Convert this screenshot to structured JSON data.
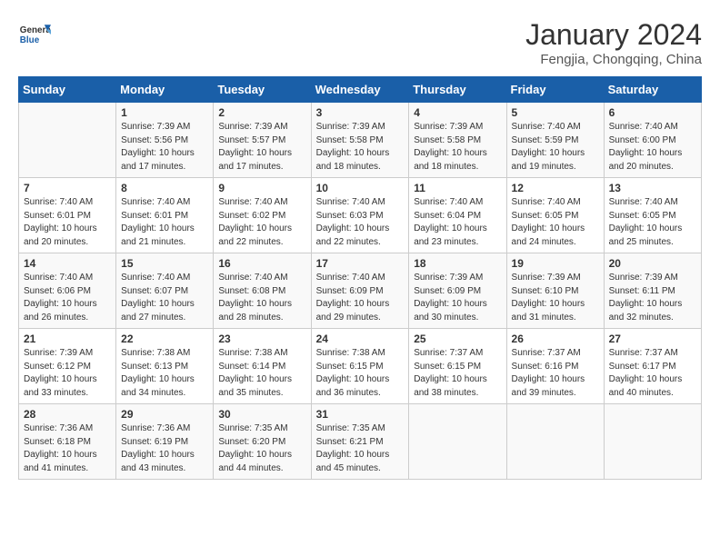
{
  "header": {
    "logo_general": "General",
    "logo_blue": "Blue",
    "title": "January 2024",
    "subtitle": "Fengjia, Chongqing, China"
  },
  "calendar": {
    "days_of_week": [
      "Sunday",
      "Monday",
      "Tuesday",
      "Wednesday",
      "Thursday",
      "Friday",
      "Saturday"
    ],
    "weeks": [
      [
        {
          "day": "",
          "info": ""
        },
        {
          "day": "1",
          "info": "Sunrise: 7:39 AM\nSunset: 5:56 PM\nDaylight: 10 hours\nand 17 minutes."
        },
        {
          "day": "2",
          "info": "Sunrise: 7:39 AM\nSunset: 5:57 PM\nDaylight: 10 hours\nand 17 minutes."
        },
        {
          "day": "3",
          "info": "Sunrise: 7:39 AM\nSunset: 5:58 PM\nDaylight: 10 hours\nand 18 minutes."
        },
        {
          "day": "4",
          "info": "Sunrise: 7:39 AM\nSunset: 5:58 PM\nDaylight: 10 hours\nand 18 minutes."
        },
        {
          "day": "5",
          "info": "Sunrise: 7:40 AM\nSunset: 5:59 PM\nDaylight: 10 hours\nand 19 minutes."
        },
        {
          "day": "6",
          "info": "Sunrise: 7:40 AM\nSunset: 6:00 PM\nDaylight: 10 hours\nand 20 minutes."
        }
      ],
      [
        {
          "day": "7",
          "info": "Sunrise: 7:40 AM\nSunset: 6:01 PM\nDaylight: 10 hours\nand 20 minutes."
        },
        {
          "day": "8",
          "info": "Sunrise: 7:40 AM\nSunset: 6:01 PM\nDaylight: 10 hours\nand 21 minutes."
        },
        {
          "day": "9",
          "info": "Sunrise: 7:40 AM\nSunset: 6:02 PM\nDaylight: 10 hours\nand 22 minutes."
        },
        {
          "day": "10",
          "info": "Sunrise: 7:40 AM\nSunset: 6:03 PM\nDaylight: 10 hours\nand 22 minutes."
        },
        {
          "day": "11",
          "info": "Sunrise: 7:40 AM\nSunset: 6:04 PM\nDaylight: 10 hours\nand 23 minutes."
        },
        {
          "day": "12",
          "info": "Sunrise: 7:40 AM\nSunset: 6:05 PM\nDaylight: 10 hours\nand 24 minutes."
        },
        {
          "day": "13",
          "info": "Sunrise: 7:40 AM\nSunset: 6:05 PM\nDaylight: 10 hours\nand 25 minutes."
        }
      ],
      [
        {
          "day": "14",
          "info": "Sunrise: 7:40 AM\nSunset: 6:06 PM\nDaylight: 10 hours\nand 26 minutes."
        },
        {
          "day": "15",
          "info": "Sunrise: 7:40 AM\nSunset: 6:07 PM\nDaylight: 10 hours\nand 27 minutes."
        },
        {
          "day": "16",
          "info": "Sunrise: 7:40 AM\nSunset: 6:08 PM\nDaylight: 10 hours\nand 28 minutes."
        },
        {
          "day": "17",
          "info": "Sunrise: 7:40 AM\nSunset: 6:09 PM\nDaylight: 10 hours\nand 29 minutes."
        },
        {
          "day": "18",
          "info": "Sunrise: 7:39 AM\nSunset: 6:09 PM\nDaylight: 10 hours\nand 30 minutes."
        },
        {
          "day": "19",
          "info": "Sunrise: 7:39 AM\nSunset: 6:10 PM\nDaylight: 10 hours\nand 31 minutes."
        },
        {
          "day": "20",
          "info": "Sunrise: 7:39 AM\nSunset: 6:11 PM\nDaylight: 10 hours\nand 32 minutes."
        }
      ],
      [
        {
          "day": "21",
          "info": "Sunrise: 7:39 AM\nSunset: 6:12 PM\nDaylight: 10 hours\nand 33 minutes."
        },
        {
          "day": "22",
          "info": "Sunrise: 7:38 AM\nSunset: 6:13 PM\nDaylight: 10 hours\nand 34 minutes."
        },
        {
          "day": "23",
          "info": "Sunrise: 7:38 AM\nSunset: 6:14 PM\nDaylight: 10 hours\nand 35 minutes."
        },
        {
          "day": "24",
          "info": "Sunrise: 7:38 AM\nSunset: 6:15 PM\nDaylight: 10 hours\nand 36 minutes."
        },
        {
          "day": "25",
          "info": "Sunrise: 7:37 AM\nSunset: 6:15 PM\nDaylight: 10 hours\nand 38 minutes."
        },
        {
          "day": "26",
          "info": "Sunrise: 7:37 AM\nSunset: 6:16 PM\nDaylight: 10 hours\nand 39 minutes."
        },
        {
          "day": "27",
          "info": "Sunrise: 7:37 AM\nSunset: 6:17 PM\nDaylight: 10 hours\nand 40 minutes."
        }
      ],
      [
        {
          "day": "28",
          "info": "Sunrise: 7:36 AM\nSunset: 6:18 PM\nDaylight: 10 hours\nand 41 minutes."
        },
        {
          "day": "29",
          "info": "Sunrise: 7:36 AM\nSunset: 6:19 PM\nDaylight: 10 hours\nand 43 minutes."
        },
        {
          "day": "30",
          "info": "Sunrise: 7:35 AM\nSunset: 6:20 PM\nDaylight: 10 hours\nand 44 minutes."
        },
        {
          "day": "31",
          "info": "Sunrise: 7:35 AM\nSunset: 6:21 PM\nDaylight: 10 hours\nand 45 minutes."
        },
        {
          "day": "",
          "info": ""
        },
        {
          "day": "",
          "info": ""
        },
        {
          "day": "",
          "info": ""
        }
      ]
    ]
  }
}
